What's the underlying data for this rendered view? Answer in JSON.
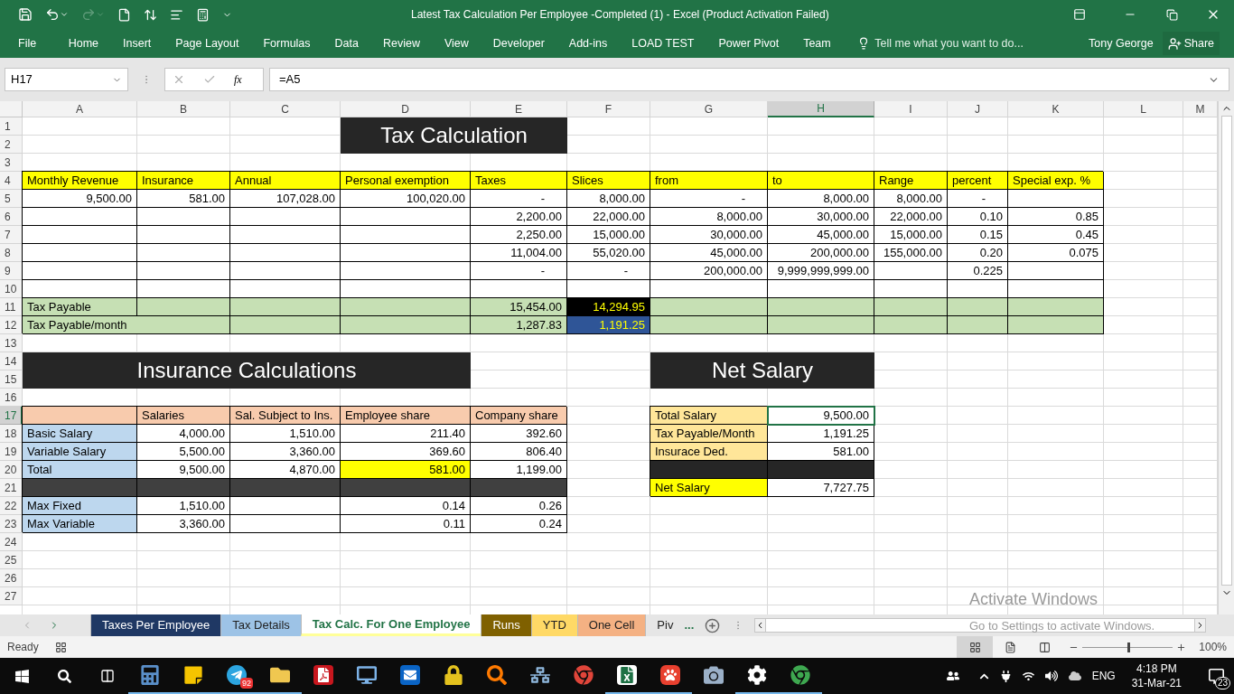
{
  "window": {
    "title": "Latest Tax Calculation Per Employee -Completed (1) - Excel (Product Activation Failed)",
    "redo_enabled": false
  },
  "ribbon": {
    "tabs": [
      "File",
      "Home",
      "Insert",
      "Page Layout",
      "Formulas",
      "Data",
      "Review",
      "View",
      "Developer",
      "Add-ins",
      "LOAD TEST",
      "Power Pivot",
      "Team"
    ],
    "tell_me": "Tell me what you want to do...",
    "user": "Tony George",
    "share": "Share"
  },
  "formula_bar": {
    "name_box": "H17",
    "function_label": "fx",
    "formula": "=A5"
  },
  "sheet": {
    "columns": [
      {
        "label": "A",
        "selected": false
      },
      {
        "label": "B",
        "selected": false
      },
      {
        "label": "C",
        "selected": false
      },
      {
        "label": "D",
        "selected": false
      },
      {
        "label": "E",
        "selected": false
      },
      {
        "label": "F",
        "selected": false
      },
      {
        "label": "G",
        "selected": false
      },
      {
        "label": "H",
        "selected": true
      },
      {
        "label": "I",
        "selected": false
      },
      {
        "label": "J",
        "selected": false
      },
      {
        "label": "K",
        "selected": false
      },
      {
        "label": "L",
        "selected": false
      },
      {
        "label": "M",
        "selected": false
      }
    ],
    "rows": [
      {
        "label": "1",
        "selected": false,
        "cells": [
          null,
          null,
          null,
          null,
          null,
          null,
          null,
          null,
          null,
          null,
          null,
          null,
          null
        ]
      },
      {
        "label": "2",
        "selected": false,
        "cells": [
          null,
          null,
          null,
          null,
          null,
          null,
          null,
          null,
          null,
          null,
          null,
          null,
          null
        ]
      },
      {
        "label": "3",
        "selected": false,
        "cells": [
          null,
          null,
          null,
          null,
          null,
          null,
          null,
          null,
          null,
          null,
          null,
          null,
          null
        ]
      },
      {
        "label": "4",
        "selected": false,
        "cells": [
          {
            "kind": "head",
            "text": "Monthly Revenue"
          },
          {
            "kind": "head",
            "text": "Insurance"
          },
          {
            "kind": "head",
            "text": "Annual"
          },
          {
            "kind": "head",
            "text": "Personal exemption"
          },
          {
            "kind": "head",
            "text": "Taxes"
          },
          {
            "kind": "head",
            "text": "Slices"
          },
          {
            "kind": "head",
            "text": "from"
          },
          {
            "kind": "head",
            "text": "to"
          },
          {
            "kind": "head",
            "text": "Range"
          },
          {
            "kind": "head",
            "text": "percent"
          },
          {
            "kind": "head",
            "text": "Special exp. %"
          },
          null,
          null
        ]
      },
      {
        "label": "5",
        "selected": false,
        "cells": [
          {
            "kind": "num",
            "text": "9,500.00"
          },
          {
            "kind": "num",
            "text": "581.00"
          },
          {
            "kind": "num",
            "text": "107,028.00"
          },
          {
            "kind": "num",
            "text": "100,020.00"
          },
          {
            "kind": "dash",
            "text": "-"
          },
          {
            "kind": "num",
            "text": "8,000.00"
          },
          {
            "kind": "dash",
            "text": "-"
          },
          {
            "kind": "num",
            "text": "8,000.00"
          },
          {
            "kind": "num",
            "text": "8,000.00"
          },
          {
            "kind": "dash",
            "text": "-"
          },
          {
            "kind": "box"
          },
          null,
          null
        ]
      },
      {
        "label": "6",
        "selected": false,
        "cells": [
          {
            "kind": "box"
          },
          {
            "kind": "box"
          },
          {
            "kind": "box"
          },
          {
            "kind": "box"
          },
          {
            "kind": "num",
            "text": "2,200.00"
          },
          {
            "kind": "num",
            "text": "22,000.00"
          },
          {
            "kind": "num",
            "text": "8,000.00"
          },
          {
            "kind": "num",
            "text": "30,000.00"
          },
          {
            "kind": "num",
            "text": "22,000.00"
          },
          {
            "kind": "num",
            "text": "0.10"
          },
          {
            "kind": "num",
            "text": "0.85"
          },
          null,
          null
        ]
      },
      {
        "label": "7",
        "selected": false,
        "cells": [
          {
            "kind": "box"
          },
          {
            "kind": "box"
          },
          {
            "kind": "box"
          },
          {
            "kind": "box"
          },
          {
            "kind": "num",
            "text": "2,250.00"
          },
          {
            "kind": "num",
            "text": "15,000.00"
          },
          {
            "kind": "num",
            "text": "30,000.00"
          },
          {
            "kind": "num",
            "text": "45,000.00"
          },
          {
            "kind": "num",
            "text": "15,000.00"
          },
          {
            "kind": "num",
            "text": "0.15"
          },
          {
            "kind": "num",
            "text": "0.45"
          },
          null,
          null
        ]
      },
      {
        "label": "8",
        "selected": false,
        "cells": [
          {
            "kind": "box"
          },
          {
            "kind": "box"
          },
          {
            "kind": "box"
          },
          {
            "kind": "box"
          },
          {
            "kind": "num",
            "text": "11,004.00"
          },
          {
            "kind": "num",
            "text": "55,020.00"
          },
          {
            "kind": "num",
            "text": "45,000.00"
          },
          {
            "kind": "num",
            "text": "200,000.00"
          },
          {
            "kind": "num",
            "text": "155,000.00"
          },
          {
            "kind": "num",
            "text": "0.20"
          },
          {
            "kind": "num",
            "text": "0.075"
          },
          null,
          null
        ]
      },
      {
        "label": "9",
        "selected": false,
        "cells": [
          {
            "kind": "box"
          },
          {
            "kind": "box"
          },
          {
            "kind": "box"
          },
          {
            "kind": "box"
          },
          {
            "kind": "dash",
            "text": "-"
          },
          {
            "kind": "dash",
            "text": "-"
          },
          {
            "kind": "num",
            "text": "200,000.00"
          },
          {
            "kind": "num",
            "text": "9,999,999,999.00"
          },
          {
            "kind": "box"
          },
          {
            "kind": "num",
            "text": "0.225"
          },
          {
            "kind": "box"
          },
          null,
          null
        ]
      },
      {
        "label": "10",
        "selected": false,
        "cells": [
          {
            "kind": "box"
          },
          {
            "kind": "box"
          },
          {
            "kind": "box"
          },
          {
            "kind": "box"
          },
          {
            "kind": "box"
          },
          {
            "kind": "box"
          },
          {
            "kind": "box"
          },
          {
            "kind": "box"
          },
          {
            "kind": "box"
          },
          {
            "kind": "box"
          },
          {
            "kind": "box"
          },
          null,
          null
        ]
      },
      {
        "label": "11",
        "selected": false,
        "cells": [
          {
            "kind": "sum",
            "text": "Tax Payable"
          },
          {
            "kind": "sum"
          },
          {
            "kind": "sum"
          },
          {
            "kind": "sum"
          },
          {
            "kind": "sumnum",
            "text": "15,454.00"
          },
          {
            "kind": "dark",
            "text": "14,294.95"
          },
          {
            "kind": "sum"
          },
          {
            "kind": "sum"
          },
          {
            "kind": "sum"
          },
          {
            "kind": "sum"
          },
          {
            "kind": "sum"
          },
          null,
          null
        ]
      },
      {
        "label": "12",
        "selected": false,
        "cells": [
          {
            "kind": "sum",
            "text": "Tax Payable/month"
          },
          null,
          {
            "kind": "sum"
          },
          {
            "kind": "sum"
          },
          {
            "kind": "sumnum",
            "text": "1,287.83"
          },
          {
            "kind": "navy",
            "text": "1,191.25"
          },
          {
            "kind": "sum"
          },
          {
            "kind": "sum"
          },
          {
            "kind": "sum"
          },
          {
            "kind": "sum"
          },
          {
            "kind": "sum"
          },
          null,
          null
        ]
      },
      {
        "label": "13",
        "selected": false,
        "cells": [
          null,
          null,
          null,
          null,
          null,
          null,
          null,
          null,
          null,
          null,
          null,
          null,
          null
        ]
      },
      {
        "label": "14",
        "selected": false,
        "cells": [
          null,
          null,
          null,
          null,
          null,
          null,
          null,
          null,
          null,
          null,
          null,
          null,
          null
        ]
      },
      {
        "label": "15",
        "selected": false,
        "cells": [
          null,
          null,
          null,
          null,
          null,
          null,
          null,
          null,
          null,
          null,
          null,
          null,
          null
        ]
      },
      {
        "label": "16",
        "selected": false,
        "cells": [
          null,
          null,
          null,
          null,
          null,
          null,
          null,
          null,
          null,
          null,
          null,
          null,
          null
        ]
      },
      {
        "label": "17",
        "selected": true,
        "cells": [
          {
            "kind": "peach"
          },
          {
            "kind": "peach",
            "text": "Salaries"
          },
          {
            "kind": "peach",
            "text": "Sal. Subject to Ins."
          },
          {
            "kind": "peach",
            "text": "Employee share"
          },
          {
            "kind": "peach",
            "text": "Company share"
          },
          null,
          {
            "kind": "tan",
            "text": "Total Salary"
          },
          {
            "kind": "active",
            "text": "9,500.00"
          },
          null,
          null,
          null,
          null,
          null
        ]
      },
      {
        "label": "18",
        "selected": false,
        "cells": [
          {
            "kind": "label",
            "text": "Basic Salary"
          },
          {
            "kind": "num",
            "text": "4,000.00"
          },
          {
            "kind": "num",
            "text": "1,510.00"
          },
          {
            "kind": "num",
            "text": "211.40"
          },
          {
            "kind": "num",
            "text": "392.60"
          },
          null,
          {
            "kind": "tan",
            "text": "Tax Payable/Month"
          },
          {
            "kind": "num",
            "text": "1,191.25"
          },
          null,
          null,
          null,
          null,
          null
        ]
      },
      {
        "label": "19",
        "selected": false,
        "cells": [
          {
            "kind": "label",
            "text": "Variable Salary"
          },
          {
            "kind": "num",
            "text": "5,500.00"
          },
          {
            "kind": "num",
            "text": "3,360.00"
          },
          {
            "kind": "num",
            "text": "369.60"
          },
          {
            "kind": "num",
            "text": "806.40"
          },
          null,
          {
            "kind": "tan",
            "text": "Insurace Ded."
          },
          {
            "kind": "num",
            "text": "581.00"
          },
          null,
          null,
          null,
          null,
          null
        ]
      },
      {
        "label": "20",
        "selected": false,
        "cells": [
          {
            "kind": "label",
            "text": "Total"
          },
          {
            "kind": "num",
            "text": "9,500.00"
          },
          {
            "kind": "num",
            "text": "4,870.00"
          },
          {
            "kind": "yellownum",
            "text": "581.00"
          },
          {
            "kind": "num",
            "text": "1,199.00"
          },
          null,
          {
            "kind": "black"
          },
          {
            "kind": "black"
          },
          null,
          null,
          null,
          null,
          null
        ]
      },
      {
        "label": "21",
        "selected": false,
        "cells": [
          {
            "kind": "band"
          },
          {
            "kind": "band"
          },
          {
            "kind": "band"
          },
          {
            "kind": "band"
          },
          {
            "kind": "band"
          },
          null,
          {
            "kind": "yellowlabel",
            "text": "Net Salary"
          },
          {
            "kind": "num",
            "text": "7,727.75"
          },
          null,
          null,
          null,
          null,
          null
        ]
      },
      {
        "label": "22",
        "selected": false,
        "cells": [
          {
            "kind": "label",
            "text": "Max Fixed"
          },
          {
            "kind": "num",
            "text": "1,510.00"
          },
          {
            "kind": "box"
          },
          {
            "kind": "num",
            "text": "0.14"
          },
          {
            "kind": "num",
            "text": "0.26"
          },
          null,
          null,
          null,
          null,
          null,
          null,
          null,
          null
        ]
      },
      {
        "label": "23",
        "selected": false,
        "cells": [
          {
            "kind": "label",
            "text": "Max Variable"
          },
          {
            "kind": "num",
            "text": "3,360.00"
          },
          {
            "kind": "box"
          },
          {
            "kind": "num",
            "text": "0.11"
          },
          {
            "kind": "num",
            "text": "0.24"
          },
          null,
          null,
          null,
          null,
          null,
          null,
          null,
          null
        ]
      },
      {
        "label": "24",
        "selected": false,
        "cells": [
          null,
          null,
          null,
          null,
          null,
          null,
          null,
          null,
          null,
          null,
          null,
          null,
          null
        ]
      },
      {
        "label": "25",
        "selected": false,
        "cells": [
          null,
          null,
          null,
          null,
          null,
          null,
          null,
          null,
          null,
          null,
          null,
          null,
          null
        ]
      },
      {
        "label": "26",
        "selected": false,
        "cells": [
          null,
          null,
          null,
          null,
          null,
          null,
          null,
          null,
          null,
          null,
          null,
          null,
          null
        ]
      },
      {
        "label": "27",
        "selected": false,
        "cells": [
          null,
          null,
          null,
          null,
          null,
          null,
          null,
          null,
          null,
          null,
          null,
          null,
          null
        ]
      }
    ],
    "titles": [
      "Tax Calculation",
      "Insurance Calculations",
      "Net Salary"
    ]
  },
  "sheet_tabs": [
    {
      "label": "Taxes Per Employee",
      "color": "#1f3864",
      "selected": false
    },
    {
      "label": "Tax Details",
      "color": "#9dc3e6",
      "selected": false
    },
    {
      "label": "Tax Calc. For One Employee",
      "color": "#ffff99",
      "selected": true
    },
    {
      "label": "Runs",
      "color": "#7f6000",
      "selected": false
    },
    {
      "label": "YTD",
      "color": "#ffd966",
      "selected": false
    },
    {
      "label": "One Cell",
      "color": "#f4b183",
      "selected": false
    },
    {
      "label": "Piv",
      "selected": false
    }
  ],
  "more_tabs": "...",
  "activation_notice": {
    "title": "Activate Windows",
    "text": "Go to Settings to activate Windows."
  },
  "status_bar": {
    "status": "Ready",
    "zoom": {
      "level": 0.5,
      "reading": "100%"
    }
  },
  "taskbar": {
    "apps": [
      {
        "running": true
      },
      {
        "running": true
      },
      {
        "running": true,
        "badge": "92"
      },
      {
        "running": true
      },
      {
        "running": false
      },
      {
        "running": false
      },
      {
        "running": false
      },
      {
        "running": false
      },
      {
        "running": false
      },
      {
        "running": false
      },
      {
        "running": false
      },
      {
        "running": true
      },
      {
        "running": true
      },
      {
        "running": false
      },
      {
        "running": true
      },
      {
        "running": true
      }
    ],
    "language": "ENG",
    "time": "4:18 PM",
    "date": "31-Mar-21",
    "notifications": "23"
  }
}
